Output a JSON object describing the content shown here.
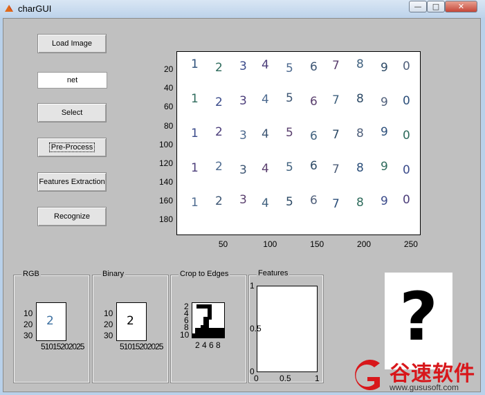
{
  "window": {
    "title": "charGUI",
    "min_icon": "minimize-icon",
    "max_icon": "maximize-icon",
    "close_icon": "close-icon"
  },
  "buttons": {
    "load": "Load Image",
    "select": "Select",
    "preprocess": "Pre-Process",
    "features": "Features Extraction",
    "recognize": "Recognize"
  },
  "net_field": {
    "value": "net"
  },
  "main_axes": {
    "y_ticks": [
      "20",
      "40",
      "60",
      "80",
      "100",
      "120",
      "140",
      "160",
      "180"
    ],
    "x_ticks": [
      "50",
      "100",
      "150",
      "200",
      "250"
    ],
    "rows": [
      [
        "1",
        "2",
        "3",
        "4",
        "5",
        "6",
        "7",
        "8",
        "9",
        "0"
      ],
      [
        "1",
        "2",
        "3",
        "4",
        "5",
        "6",
        "7",
        "8",
        "9",
        "0"
      ],
      [
        "1",
        "2",
        "3",
        "4",
        "5",
        "6",
        "7",
        "8",
        "9",
        "0"
      ],
      [
        "1",
        "2",
        "3",
        "4",
        "5",
        "6",
        "7",
        "8",
        "9",
        "0"
      ],
      [
        "1",
        "2",
        "3",
        "4",
        "5",
        "6",
        "7",
        "8",
        "9",
        "0"
      ]
    ]
  },
  "panels": {
    "rgb": {
      "label": "RGB",
      "y_ticks": [
        "10",
        "20",
        "30"
      ],
      "x_ticks": "51015202025",
      "glyph": "2"
    },
    "binary": {
      "label": "Binary",
      "y_ticks": [
        "10",
        "20",
        "30"
      ],
      "x_ticks": "51015202025",
      "glyph": "2"
    },
    "crop": {
      "label": "Crop to Edges",
      "y_ticks": [
        "2",
        "4",
        "6",
        "8",
        "10"
      ],
      "x_ticks": "2 4 6 8"
    },
    "features": {
      "label": "Features",
      "y_ticks": [
        "1",
        "0.5",
        "0"
      ],
      "x_ticks": [
        "0",
        "0.5",
        "1"
      ]
    }
  },
  "result": {
    "text": "?"
  },
  "watermark": {
    "text": "谷速软件",
    "url": "www.gususoft.com",
    "brand_color": "#d8171b"
  }
}
